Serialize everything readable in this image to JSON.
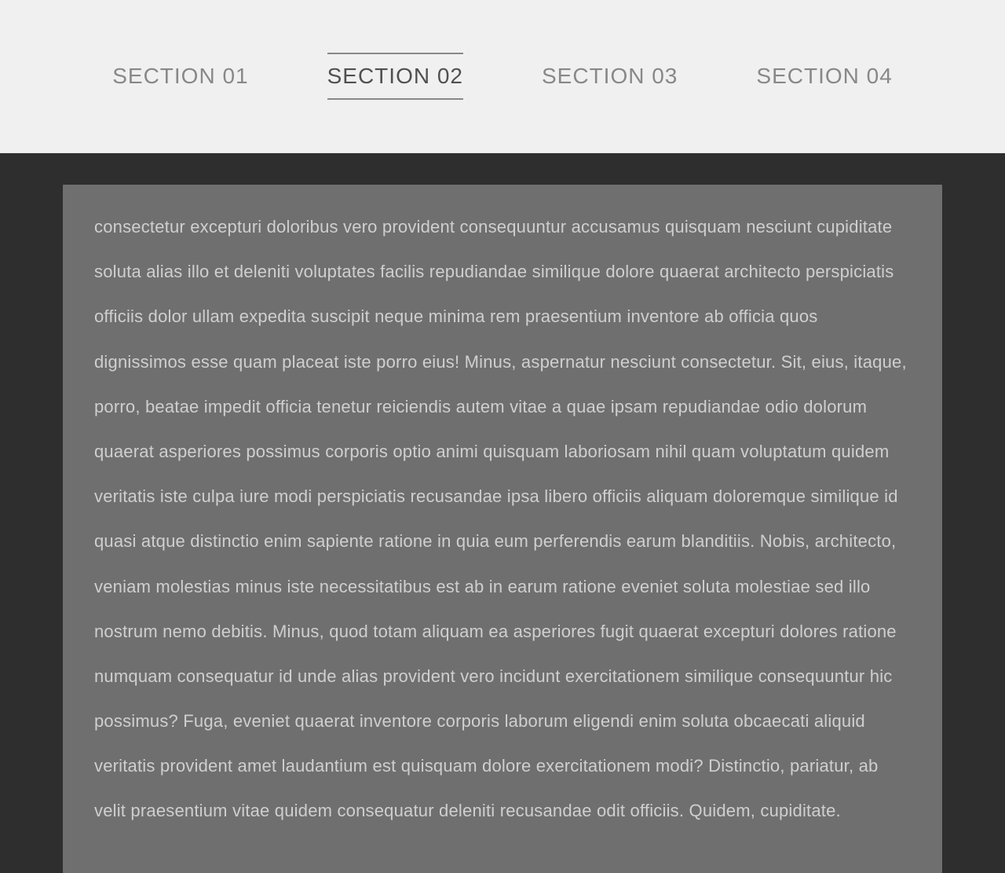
{
  "nav": {
    "items": [
      {
        "label": "SECTION 01"
      },
      {
        "label": "SECTION 02"
      },
      {
        "label": "SECTION 03"
      },
      {
        "label": "SECTION 04"
      }
    ],
    "activeIndex": 1
  },
  "content": {
    "body": "consectetur excepturi doloribus vero provident consequuntur accusamus quisquam nesciunt cupiditate soluta alias illo et deleniti voluptates facilis repudiandae similique dolore quaerat architecto perspiciatis officiis dolor ullam expedita suscipit neque minima rem praesentium inventore ab officia quos dignissimos esse quam placeat iste porro eius! Minus, aspernatur nesciunt consectetur. Sit, eius, itaque, porro, beatae impedit officia tenetur reiciendis autem vitae a quae ipsam repudiandae odio dolorum quaerat asperiores possimus corporis optio animi quisquam laboriosam nihil quam voluptatum quidem veritatis iste culpa iure modi perspiciatis recusandae ipsa libero officiis aliquam doloremque similique id quasi atque distinctio enim sapiente ratione in quia eum perferendis earum blanditiis. Nobis, architecto, veniam molestias minus iste necessitatibus est ab in earum ratione eveniet soluta molestiae sed illo nostrum nemo debitis. Minus, quod totam aliquam ea asperiores fugit quaerat excepturi dolores ratione numquam consequatur id unde alias provident vero incidunt exercitationem similique consequuntur hic possimus? Fuga, eveniet quaerat inventore corporis laborum eligendi enim soluta obcaecati aliquid veritatis provident amet laudantium est quisquam dolore exercitationem modi? Distinctio, pariatur, ab velit praesentium vitae quidem consequatur deleniti recusandae odit officiis. Quidem, cupiditate."
  }
}
